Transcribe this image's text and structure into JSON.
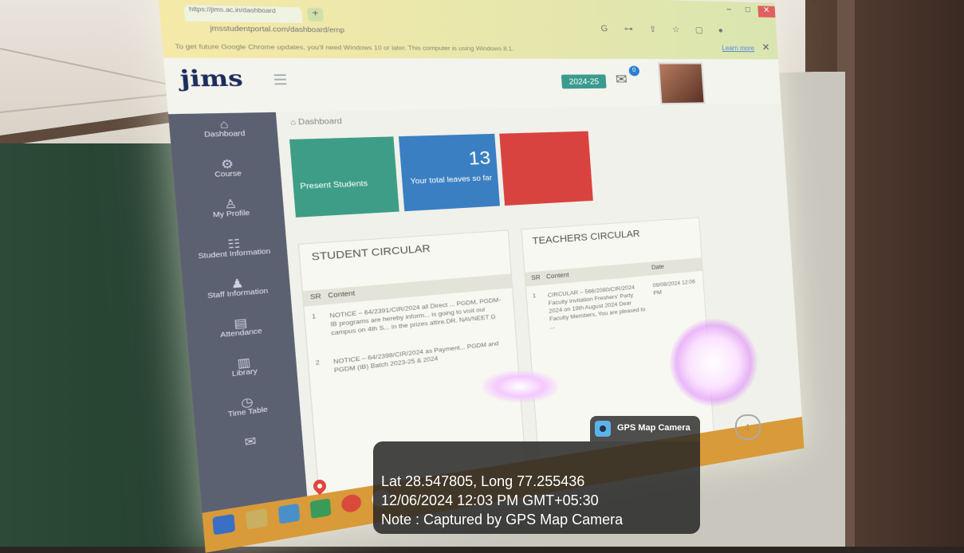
{
  "browser": {
    "tab_title": "https://jims.ac.in/dashboard",
    "url": "jmsstudentportal.com/dashboard/emp",
    "update_warning": "To get future Google Chrome updates, you'll need Windows 10 or later. This computer is using Windows 8.1.",
    "learn_more": "Learn more",
    "toolbar_icons": "G ⊶ ⇪ ☆ ▢ ●"
  },
  "app": {
    "logo": "jims",
    "year": "2024-25",
    "mail_count": "0",
    "breadcrumb": "⌂ Dashboard",
    "sidebar": [
      {
        "icon": "⌂",
        "label": "Dashboard"
      },
      {
        "icon": "⚙",
        "label": "Course"
      },
      {
        "icon": "♙",
        "label": "My Profile"
      },
      {
        "icon": "☷",
        "label": "Student Information"
      },
      {
        "icon": "♟",
        "label": "Staff Information"
      },
      {
        "icon": "▤",
        "label": "Attendance"
      },
      {
        "icon": "▥",
        "label": "Library"
      },
      {
        "icon": "◷",
        "label": "Time Table"
      },
      {
        "icon": "✉",
        "label": ""
      }
    ],
    "cards": {
      "present_label": "Present Students",
      "leaves_count": "13",
      "leaves_label": "Your total leaves so far"
    },
    "student_circular": {
      "title": "STUDENT CIRCULAR",
      "col_sr": "SR",
      "col_content": "Content",
      "rows": [
        {
          "sr": "1",
          "text": "NOTICE – 64/2391/CIR/2024 all Direct ... PGDM, PGDM-IB programs are hereby inform... is going to visit our campus on 4th S... in the prizes attire.DR. NAVNEET G"
        },
        {
          "sr": "2",
          "text": "NOTICE – 64/2398/CIR/2024 as Payment... PGDM and PGDM (IB) Batch 2023-25 & 2024"
        }
      ]
    },
    "teachers_circular": {
      "title": "TEACHERS CIRCULAR",
      "col_sr": "SR",
      "col_content": "Content",
      "col_date": "Date",
      "rows": [
        {
          "sr": "1",
          "text": "CIRCULAR – 566/2080/CIR/2024 Faculty Invitation Freshers' Party 2024 on 19th August 2024 Dear Faculty Members, You are pleased to ...",
          "date": "09/08/2024 12:06 PM"
        }
      ]
    }
  },
  "gps": {
    "tag_label": "GPS Map Camera",
    "lat_long": "Lat 28.547805, Long 77.255436",
    "datetime": "12/06/2024 12:03 PM GMT+05:30",
    "note": "Note : Captured by GPS Map Camera"
  },
  "colors": {
    "card_green": "#3e9d86",
    "card_blue": "#3a7fc2",
    "card_red": "#d9433f",
    "sidebar": "#5c6172",
    "taskbar": "#d99a3a"
  }
}
